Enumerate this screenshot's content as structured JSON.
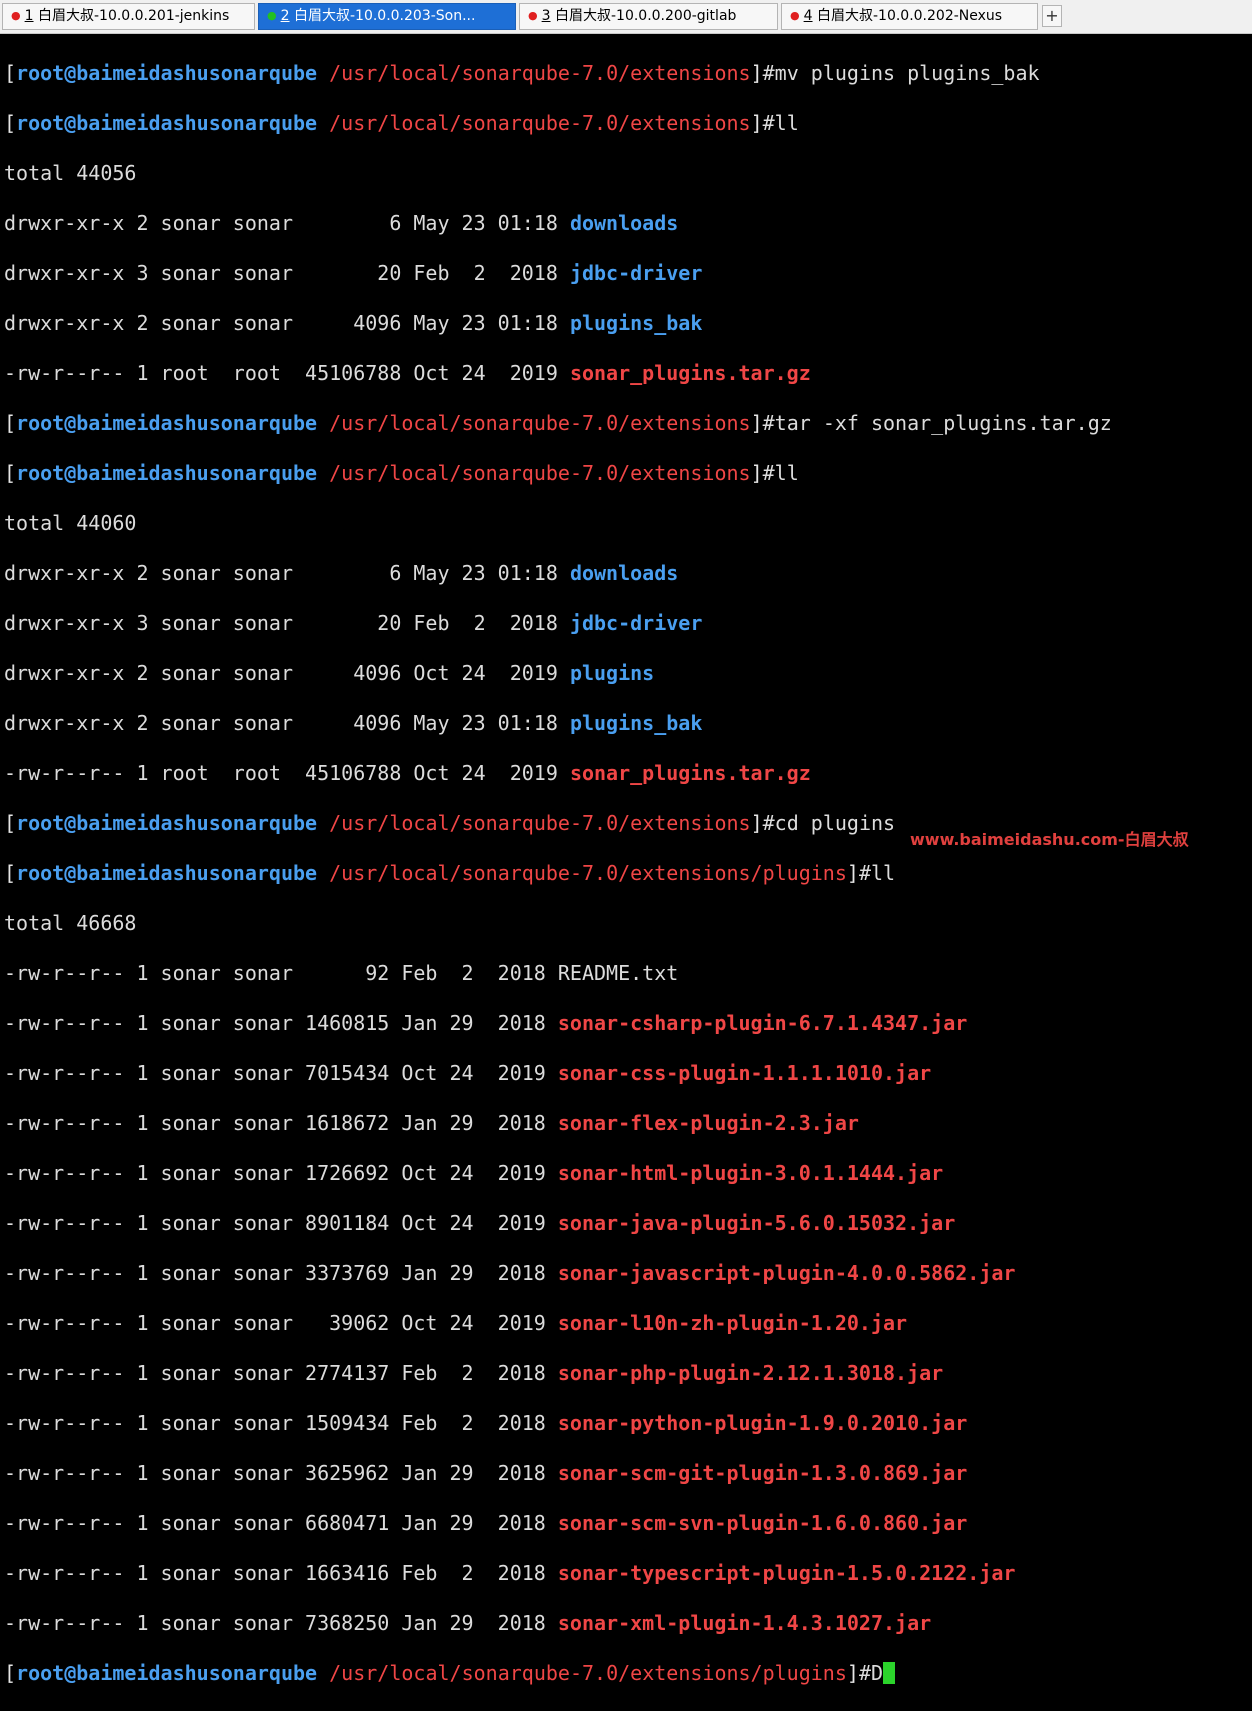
{
  "tabs": [
    {
      "num": "1",
      "title": " 白眉大叔-10.0.0.201-jenkins",
      "dot_color": "#e02020",
      "active": false
    },
    {
      "num": "2",
      "title": " 白眉大叔-10.0.0.203-Son...",
      "dot_color": "#22c022",
      "active": true
    },
    {
      "num": "3",
      "title": " 白眉大叔-10.0.0.200-gitlab",
      "dot_color": "#e02020",
      "active": false
    },
    {
      "num": "4",
      "title": " 白眉大叔-10.0.0.202-Nexus",
      "dot_color": "#e02020",
      "active": false
    }
  ],
  "new_tab_label": "+",
  "terminal": {
    "user_host": "root@baimeidashusonarqube",
    "path_ext": "/usr/local/sonarqube-7.0/extensions",
    "path_plugins": "/usr/local/sonarqube-7.0/extensions/plugins",
    "commands": [
      "#mv plugins plugins_bak",
      "#ll",
      "#tar -xf sonar_plugins.tar.gz",
      "#ll",
      "#cd plugins",
      "#ll",
      "#D"
    ],
    "total1": "total 44056",
    "ls1": [
      {
        "meta": "drwxr-xr-x 2 sonar sonar        6 May 23 01:18 ",
        "name": "downloads"
      },
      {
        "meta": "drwxr-xr-x 3 sonar sonar       20 Feb  2  2018 ",
        "name": "jdbc-driver"
      },
      {
        "meta": "drwxr-xr-x 2 sonar sonar     4096 May 23 01:18 ",
        "name": "plugins_bak"
      },
      {
        "meta": "-rw-r--r-- 1 root  root  45106788 Oct 24  2019 ",
        "name": "sonar_plugins.tar.gz"
      }
    ],
    "total2": "total 44060",
    "ls2": [
      {
        "meta": "drwxr-xr-x 2 sonar sonar        6 May 23 01:18 ",
        "name": "downloads"
      },
      {
        "meta": "drwxr-xr-x 3 sonar sonar       20 Feb  2  2018 ",
        "name": "jdbc-driver"
      },
      {
        "meta": "drwxr-xr-x 2 sonar sonar     4096 Oct 24  2019 ",
        "name": "plugins"
      },
      {
        "meta": "drwxr-xr-x 2 sonar sonar     4096 May 23 01:18 ",
        "name": "plugins_bak"
      },
      {
        "meta": "-rw-r--r-- 1 root  root  45106788 Oct 24  2019 ",
        "name": "sonar_plugins.tar.gz"
      }
    ],
    "total3": "total 46668",
    "ls3": [
      {
        "meta": "-rw-r--r-- 1 sonar sonar      92 Feb  2  2018 ",
        "name": "README.txt"
      },
      {
        "meta": "-rw-r--r-- 1 sonar sonar 1460815 Jan 29  2018 ",
        "name": "sonar-csharp-plugin-6.7.1.4347.jar"
      },
      {
        "meta": "-rw-r--r-- 1 sonar sonar 7015434 Oct 24  2019 ",
        "name": "sonar-css-plugin-1.1.1.1010.jar"
      },
      {
        "meta": "-rw-r--r-- 1 sonar sonar 1618672 Jan 29  2018 ",
        "name": "sonar-flex-plugin-2.3.jar"
      },
      {
        "meta": "-rw-r--r-- 1 sonar sonar 1726692 Oct 24  2019 ",
        "name": "sonar-html-plugin-3.0.1.1444.jar"
      },
      {
        "meta": "-rw-r--r-- 1 sonar sonar 8901184 Oct 24  2019 ",
        "name": "sonar-java-plugin-5.6.0.15032.jar"
      },
      {
        "meta": "-rw-r--r-- 1 sonar sonar 3373769 Jan 29  2018 ",
        "name": "sonar-javascript-plugin-4.0.0.5862.jar"
      },
      {
        "meta": "-rw-r--r-- 1 sonar sonar   39062 Oct 24  2019 ",
        "name": "sonar-l10n-zh-plugin-1.20.jar"
      },
      {
        "meta": "-rw-r--r-- 1 sonar sonar 2774137 Feb  2  2018 ",
        "name": "sonar-php-plugin-2.12.1.3018.jar"
      },
      {
        "meta": "-rw-r--r-- 1 sonar sonar 1509434 Feb  2  2018 ",
        "name": "sonar-python-plugin-1.9.0.2010.jar"
      },
      {
        "meta": "-rw-r--r-- 1 sonar sonar 3625962 Jan 29  2018 ",
        "name": "sonar-scm-git-plugin-1.3.0.869.jar"
      },
      {
        "meta": "-rw-r--r-- 1 sonar sonar 6680471 Jan 29  2018 ",
        "name": "sonar-scm-svn-plugin-1.6.0.860.jar"
      },
      {
        "meta": "-rw-r--r-- 1 sonar sonar 1663416 Feb  2  2018 ",
        "name": "sonar-typescript-plugin-1.5.0.2122.jar"
      },
      {
        "meta": "-rw-r--r-- 1 sonar sonar 7368250 Jan 29  2018 ",
        "name": "sonar-xml-plugin-1.4.3.1027.jar"
      }
    ]
  },
  "watermark": "www.baimeidashu.com-白眉大叔",
  "colors": {
    "prompt_user": "#4a9ff0",
    "prompt_path": "#f04646",
    "dir": "#4a9ff0",
    "archive": "#f04646",
    "cursor": "#2bd42b",
    "active_tab": "#1e6fd6"
  }
}
